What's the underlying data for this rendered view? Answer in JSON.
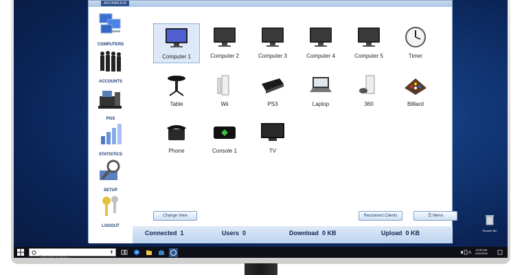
{
  "brand": "ANTAMEDIA",
  "sidebar": {
    "items": [
      {
        "label": "COMPUTERS",
        "icon": "computers-icon"
      },
      {
        "label": "ACCOUNTS",
        "icon": "accounts-icon"
      },
      {
        "label": "POS",
        "icon": "pos-icon"
      },
      {
        "label": "STATISTICS",
        "icon": "statistics-icon"
      },
      {
        "label": "SETUP",
        "icon": "setup-icon"
      },
      {
        "label": "LOGOUT",
        "icon": "logout-icon"
      }
    ]
  },
  "tiles": [
    {
      "label": "Computer 1",
      "icon": "monitor-icon",
      "selected": true
    },
    {
      "label": "Computer 2",
      "icon": "monitor-icon"
    },
    {
      "label": "Computer 3",
      "icon": "monitor-icon"
    },
    {
      "label": "Computer 4",
      "icon": "monitor-icon"
    },
    {
      "label": "Computer 5",
      "icon": "monitor-icon"
    },
    {
      "label": "Timer",
      "icon": "clock-icon"
    },
    {
      "label": "Table",
      "icon": "table-icon"
    },
    {
      "label": "Wii",
      "icon": "wii-icon"
    },
    {
      "label": "PS3",
      "icon": "ps3-icon"
    },
    {
      "label": "Laptop",
      "icon": "laptop-icon"
    },
    {
      "label": "360",
      "icon": "xbox360-icon"
    },
    {
      "label": "Billiard",
      "icon": "billiard-icon"
    },
    {
      "label": "Phone",
      "icon": "phone-icon"
    },
    {
      "label": "Console 1",
      "icon": "console-icon"
    },
    {
      "label": "TV",
      "icon": "tv-icon"
    }
  ],
  "toolbar": {
    "change_view": "Change View",
    "reconnect": "Reconnect Clients",
    "menu": "Menu"
  },
  "status": {
    "connected_label": "Connected",
    "connected_value": "1",
    "users_label": "Users",
    "users_value": "0",
    "download_label": "Download",
    "download_value": "0 KB",
    "upload_label": "Upload",
    "upload_value": "0 KB"
  },
  "taskbar": {
    "search_placeholder": "Type here to search",
    "time": "10:59 AM",
    "date": "3/22/2018"
  },
  "desktop": {
    "recycle_bin": "Recycle Bin"
  },
  "colors": {
    "accent": "#1c3c72",
    "selection": "#dde8f8",
    "desktop": "#123a7a"
  }
}
